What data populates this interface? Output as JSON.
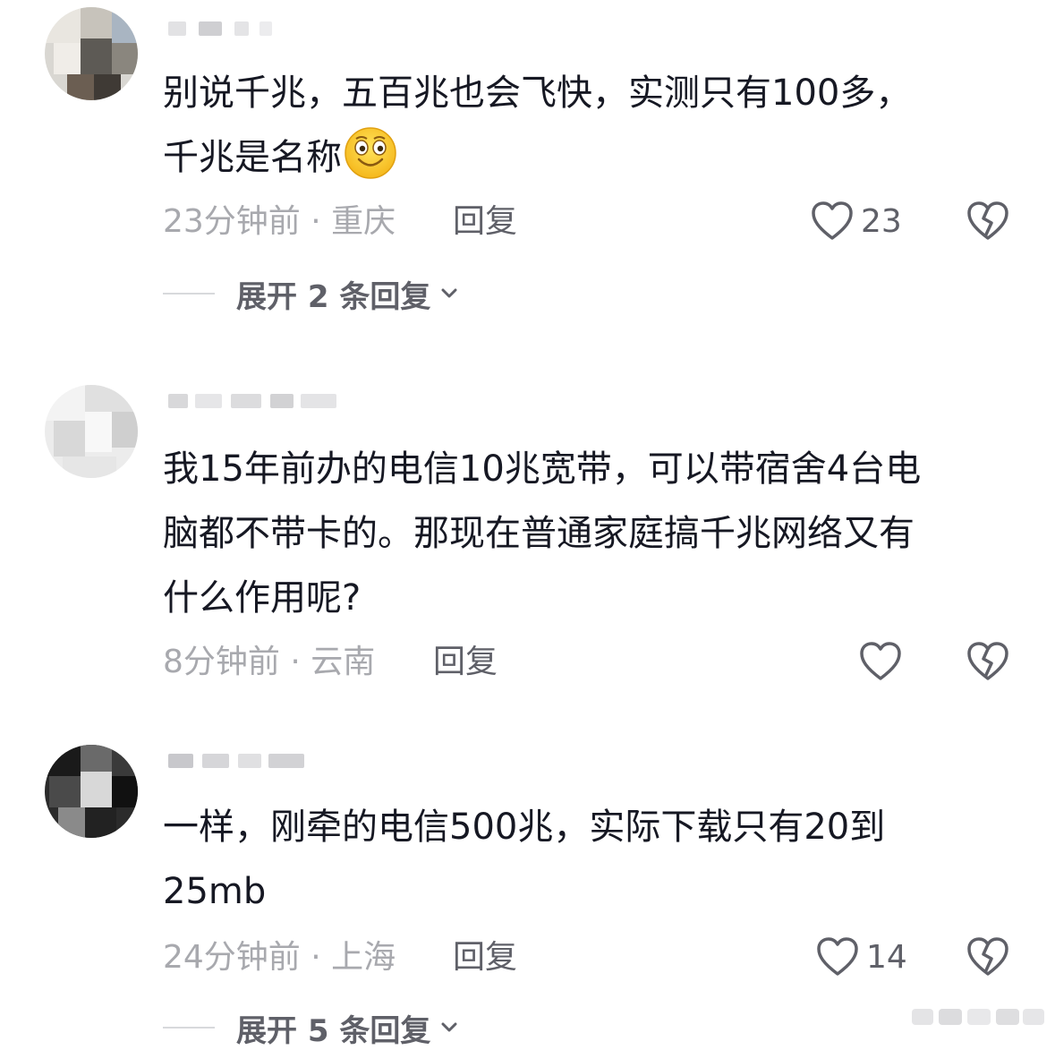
{
  "comments": [
    {
      "line1": "别说千兆，五百兆也会飞快，实测只有100多，",
      "line2": "千兆是名称",
      "emoji": "grin-face-icon",
      "time": "23分钟前 · 重庆",
      "reply": "回复",
      "likes": "23",
      "expand": "展开 2 条回复"
    },
    {
      "line1": "我15年前办的电信10兆宽带，可以带宿舍4台电",
      "line2": "脑都不带卡的。那现在普通家庭搞千兆网络又有",
      "line3": "什么作用呢?",
      "time": "8分钟前 · 云南",
      "reply": "回复",
      "likes": ""
    },
    {
      "line1": "一样，刚牵的电信500兆，实际下载只有20到",
      "line2": "25mb",
      "time": "24分钟前 · 上海",
      "reply": "回复",
      "likes": "14",
      "expand": "展开 5 条回复"
    }
  ],
  "colors": {
    "text": "#161823",
    "meta": "#a8a9ae",
    "action": "#5f6068"
  }
}
